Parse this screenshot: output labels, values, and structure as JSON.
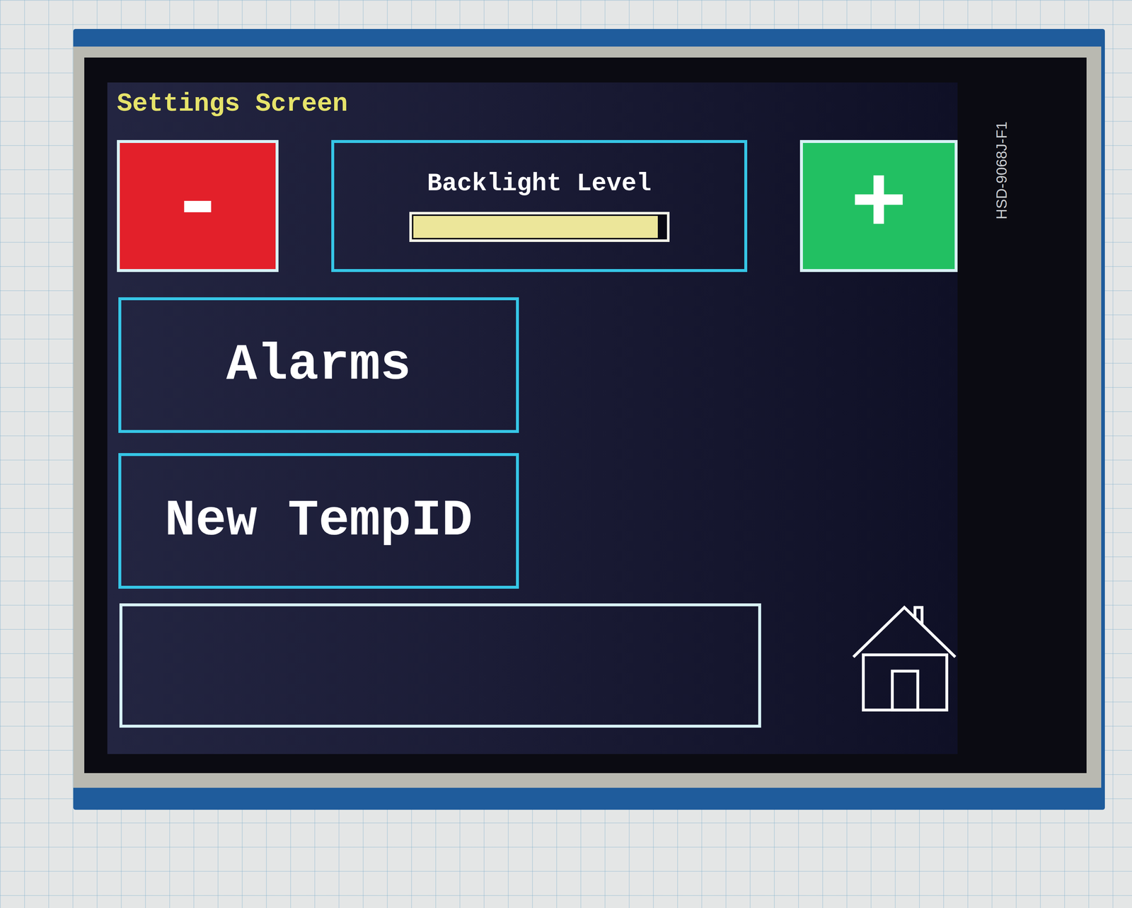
{
  "screen_title": "Settings Screen",
  "backlight": {
    "decrease": "-",
    "label": "Backlight Level",
    "level": 0.97,
    "increase": "+"
  },
  "menu": [
    {
      "label": "Alarms"
    },
    {
      "label": "New TempID"
    }
  ],
  "board_label": "HSD-9068J-F1"
}
